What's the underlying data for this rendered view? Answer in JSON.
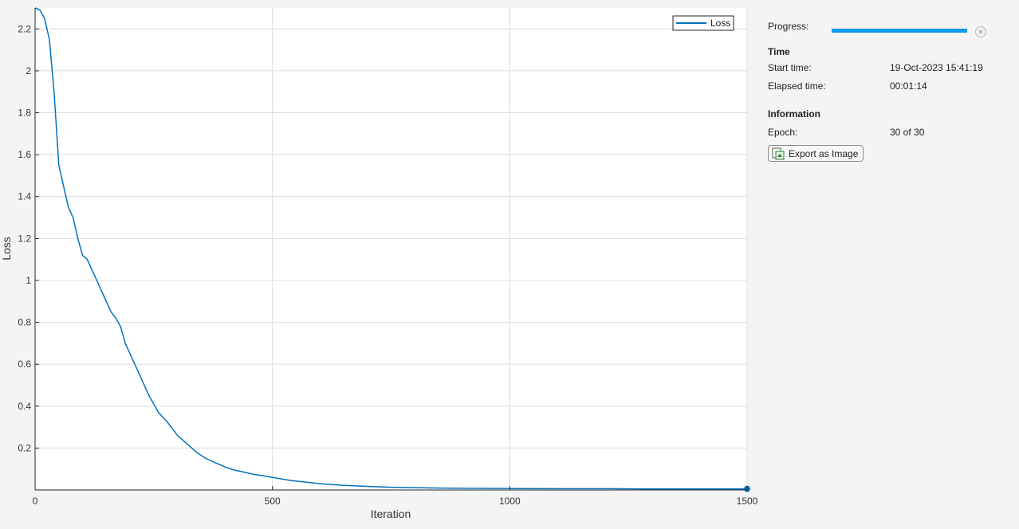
{
  "chart_data": {
    "type": "line",
    "xlabel": "Iteration",
    "ylabel": "Loss",
    "xlim": [
      0,
      1500
    ],
    "ylim": [
      0,
      2.3
    ],
    "xticks": [
      0,
      500,
      1000,
      1500
    ],
    "yticks": [
      0.2,
      0.4,
      0.6,
      0.8,
      1,
      1.2,
      1.4,
      1.6,
      1.8,
      2,
      2.2
    ],
    "grid": true,
    "legend": {
      "position": "top-right",
      "entries": [
        "Loss"
      ]
    },
    "series": [
      {
        "name": "Loss",
        "color": "#0072bd",
        "final_point": [
          1500,
          0.005
        ],
        "x": [
          0,
          10,
          20,
          30,
          40,
          50,
          60,
          70,
          80,
          90,
          100,
          110,
          120,
          130,
          140,
          150,
          160,
          170,
          180,
          190,
          200,
          220,
          240,
          260,
          280,
          300,
          320,
          340,
          360,
          380,
          400,
          420,
          440,
          460,
          480,
          500,
          520,
          540,
          560,
          580,
          600,
          650,
          700,
          750,
          800,
          850,
          900,
          1000,
          1100,
          1200,
          1300,
          1400,
          1500
        ],
        "values": [
          2.3,
          2.29,
          2.25,
          2.15,
          1.9,
          1.55,
          1.45,
          1.35,
          1.3,
          1.2,
          1.12,
          1.1,
          1.05,
          1.0,
          0.95,
          0.9,
          0.85,
          0.82,
          0.78,
          0.7,
          0.65,
          0.55,
          0.45,
          0.37,
          0.32,
          0.26,
          0.22,
          0.18,
          0.15,
          0.13,
          0.11,
          0.095,
          0.085,
          0.075,
          0.068,
          0.06,
          0.052,
          0.045,
          0.04,
          0.035,
          0.03,
          0.022,
          0.017,
          0.013,
          0.011,
          0.009,
          0.008,
          0.007,
          0.006,
          0.006,
          0.005,
          0.005,
          0.005
        ]
      }
    ]
  },
  "info": {
    "progress_label": "Progress:",
    "progress_fraction": 1.0,
    "progress_color": "#0e99f0",
    "time_heading": "Time",
    "start_time_label": "Start time:",
    "start_time_value": "19-Oct-2023 15:41:19",
    "elapsed_time_label": "Elapsed time:",
    "elapsed_time_value": "00:01:14",
    "information_heading": "Information",
    "epoch_label": "Epoch:",
    "epoch_value": "30 of 30",
    "export_label": "Export as Image",
    "stop_icon": "stop-icon",
    "export_icon": "export-image-icon"
  }
}
